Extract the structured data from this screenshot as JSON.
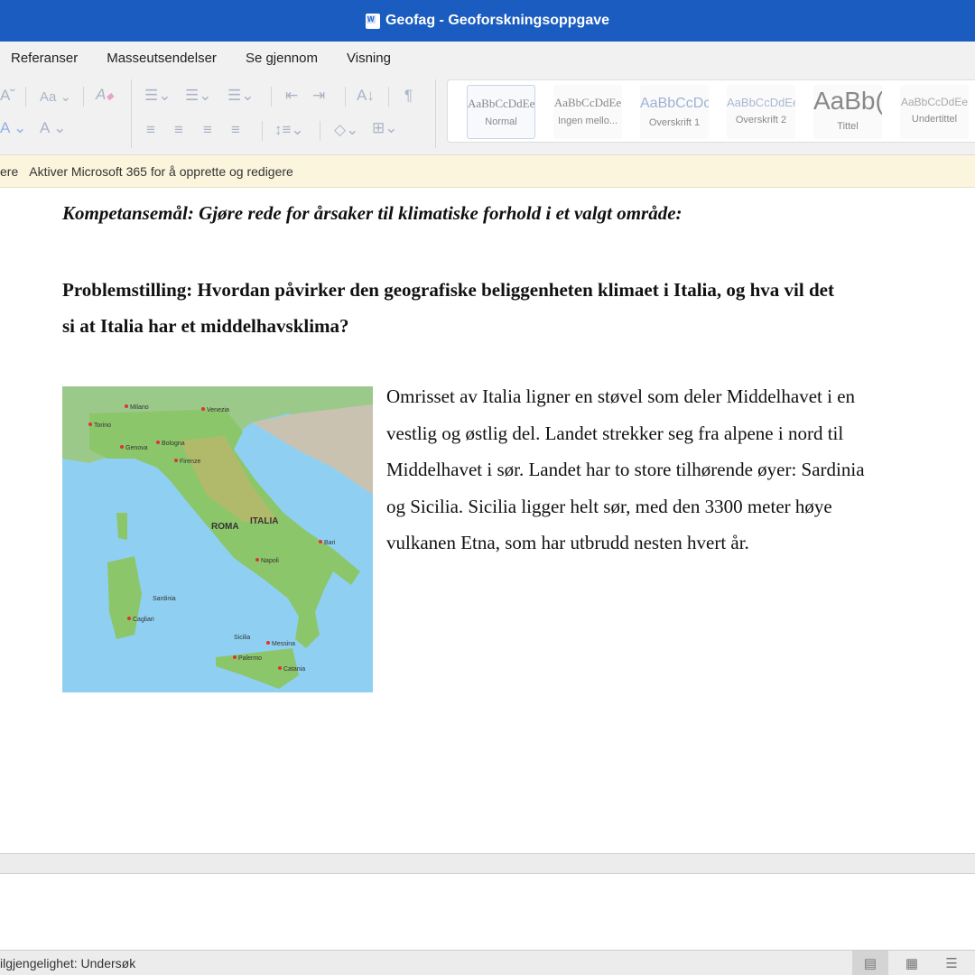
{
  "window": {
    "title": "Geofag - Geoforskningsoppgave",
    "app_icon": "word-icon"
  },
  "tabs": [
    "Referanser",
    "Masseutsendelser",
    "Se gjennom",
    "Visning"
  ],
  "ribbon": {
    "font_case": "Aa",
    "font_color": "A",
    "highlight": "A",
    "pilcrow": "¶"
  },
  "styles": [
    {
      "preview": "AaBbCcDdEe",
      "label": "Normal",
      "color": "#888",
      "size": 13,
      "selected": true
    },
    {
      "preview": "AaBbCcDdEe",
      "label": "Ingen mello...",
      "color": "#888",
      "size": 13
    },
    {
      "preview": "AaBbCcDc",
      "label": "Overskrift 1",
      "color": "#9fb2d6",
      "size": 16
    },
    {
      "preview": "AaBbCcDdEe",
      "label": "Overskrift 2",
      "color": "#aab8d4",
      "size": 13
    },
    {
      "preview": "AaBb(",
      "label": "Tittel",
      "color": "#888",
      "size": 28
    },
    {
      "preview": "AaBbCcDdEe",
      "label": "Undertittel",
      "color": "#aaa",
      "size": 12
    }
  ],
  "notice": {
    "prefix": "ere",
    "text": "Aktiver Microsoft 365 for å opprette og redigere"
  },
  "document": {
    "competence": "Kompetansemål: Gjøre rede for årsaker til klimatiske forhold i et valgt område:",
    "problem": "Problemstilling: Hvordan påvirker den geografiske beliggenheten klimaet i Italia, og hva vil det si at Italia har et middelhavsklima?",
    "body": " Omrisset av Italia ligner en støvel som deler Middelhavet i en vestlig og østlig del. Landet strekker seg fra alpene i nord til Middelhavet i sør. Landet har to store tilhørende øyer: Sardinia og Sicilia. Sicilia ligger helt sør, med den 3300 meter høye vulkanen Etna, som har utbrudd nesten hvert år."
  },
  "map": {
    "labels": [
      "ITALIA",
      "ROMA",
      "Milano",
      "Torino",
      "Venezia",
      "Bologna",
      "Firenze",
      "Genova",
      "Napoli",
      "Bari",
      "Sardinia",
      "Cagliari",
      "Palermo",
      "Catania",
      "Messina",
      "Sicilia"
    ],
    "sea_color": "#8fd0f2",
    "land_color": "#8cc66a"
  },
  "status": {
    "accessibility": "ilgjengelighet: Undersøk"
  }
}
